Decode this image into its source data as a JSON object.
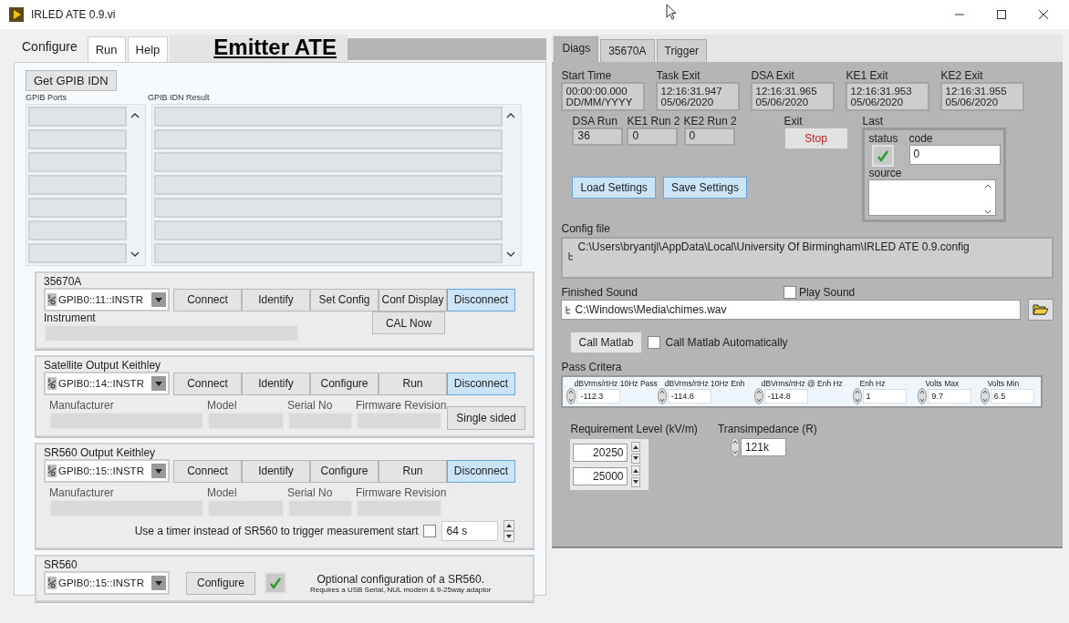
{
  "window": {
    "title": "IRLED ATE 0.9.vi"
  },
  "left": {
    "tabs": [
      {
        "label": "Configure",
        "selected": true
      },
      {
        "label": "Run",
        "selected": false
      },
      {
        "label": "Help",
        "selected": false
      }
    ],
    "heading": "Emitter ATE",
    "get_idn_button": "Get GPIB IDN",
    "ports_label": "GPIB Ports",
    "result_label": "GPIB IDN Result",
    "dsa": {
      "title": "35670A",
      "resource": "GPIB0::11::INSTR",
      "buttons": [
        {
          "label": "Connect",
          "active": false
        },
        {
          "label": "Identify",
          "active": false
        },
        {
          "label": "Set Config",
          "active": false
        },
        {
          "label": "Conf Display",
          "active": false
        },
        {
          "label": "Disconnect",
          "active": true
        }
      ],
      "instrument_label": "Instrument",
      "cal_button": "CAL Now"
    },
    "satellite": {
      "title": "Satellite Output Keithley",
      "resource": "GPIB0::14::INSTR",
      "buttons": [
        {
          "label": "Connect",
          "active": false
        },
        {
          "label": "Identify",
          "active": false
        },
        {
          "label": "Configure",
          "active": false
        },
        {
          "label": "Run",
          "active": false
        },
        {
          "label": "Disconnect",
          "active": true
        }
      ],
      "fields": [
        "Manufacturer",
        "Model",
        "Serial No",
        "Firmware Revision"
      ],
      "side_button": "Single sided"
    },
    "sr560_output": {
      "title": "SR560 Output Keithley",
      "resource": "GPIB0::15::INSTR",
      "buttons": [
        {
          "label": "Connect",
          "active": false
        },
        {
          "label": "Identify",
          "active": false
        },
        {
          "label": "Configure",
          "active": false
        },
        {
          "label": "Run",
          "active": false
        },
        {
          "label": "Disconnect",
          "active": true
        }
      ],
      "fields": [
        "Manufacturer",
        "Model",
        "Serial No",
        "Firmware Revision"
      ],
      "timer_label": "Use a timer instead of SR560 to trigger measurement start",
      "timer_checked": false,
      "timer_value": "64 s"
    },
    "sr560": {
      "title": "SR560",
      "resource": "GPIB0::15::INSTR",
      "configure_button": "Configure",
      "enabled": true,
      "note": "Optional configuration of a SR560.",
      "note_small": "Requires a USB Serial, NUL modem & 9-25way adaptor"
    }
  },
  "right": {
    "tabs": [
      {
        "label": "Diags",
        "selected": true
      },
      {
        "label": "35670A",
        "selected": false
      },
      {
        "label": "Trigger",
        "selected": false
      }
    ],
    "times": [
      {
        "label": "Start Time",
        "line1": "00:00:00.000",
        "line2": "DD/MM/YYYY"
      },
      {
        "label": "Task Exit",
        "line1": "12:16:31.947",
        "line2": "05/06/2020"
      },
      {
        "label": "DSA Exit",
        "line1": "12:16:31.965",
        "line2": "05/06/2020"
      },
      {
        "label": "KE1 Exit",
        "line1": "12:16:31.953",
        "line2": "05/06/2020"
      },
      {
        "label": "KE2 Exit",
        "line1": "12:16:31.955",
        "line2": "05/06/2020"
      }
    ],
    "runs": [
      {
        "label": "DSA Run",
        "value": "36"
      },
      {
        "label": "KE1 Run 2",
        "value": "0"
      },
      {
        "label": "KE2 Run 2",
        "value": "0"
      }
    ],
    "exit": {
      "label": "Exit",
      "button": "Stop"
    },
    "last": {
      "label": "Last",
      "status_label": "status",
      "status_ok": true,
      "code_label": "code",
      "code": "0",
      "source_label": "source"
    },
    "load_button": "Load Settings",
    "save_button": "Save Settings",
    "config_file": {
      "label": "Config file",
      "path": "C:\\Users\\bryantjl\\AppData\\Local\\University Of Birmingham\\IRLED ATE 0.9.config"
    },
    "finished_sound": {
      "label": "Finished Sound",
      "path": "C:\\Windows\\Media\\chimes.wav",
      "play_label": "Play Sound",
      "play_checked": false
    },
    "call_matlab_button": "Call Matlab",
    "call_matlab_auto": {
      "label": "Call Matlab Automatically",
      "checked": false
    },
    "pass_criteria": {
      "label": "Pass Critera",
      "items": [
        {
          "label": "dBVrms/rtHz 10Hz Pass",
          "value": "-112.3"
        },
        {
          "label": "dBVrms/rtHz 10Hz Enh",
          "value": "-114.8"
        },
        {
          "label": "dBVrms/rtHz @ Enh Hz",
          "value": "-114.8"
        },
        {
          "label": "Enh Hz",
          "value": "1"
        },
        {
          "label": "Volts Max",
          "value": "9.7"
        },
        {
          "label": "Volts Min",
          "value": "6.5"
        }
      ]
    },
    "requirement": {
      "label": "Requirement Level (kV/m)",
      "values": [
        "20250",
        "25000"
      ]
    },
    "transimpedance": {
      "label": "Transimpedance (R)",
      "value": "121k"
    }
  }
}
